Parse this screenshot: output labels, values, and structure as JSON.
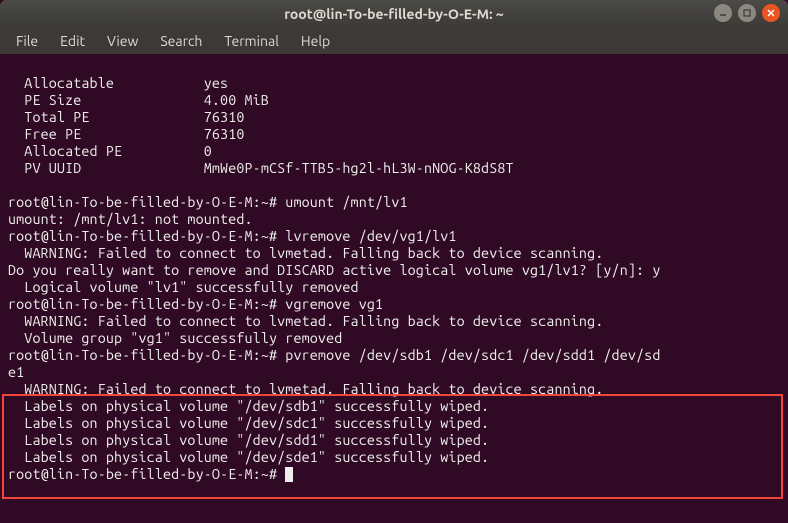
{
  "window": {
    "title": "root@lin-To-be-filled-by-O-E-M: ~"
  },
  "menu": {
    "file": "File",
    "edit": "Edit",
    "view": "View",
    "search": "Search",
    "terminal": "Terminal",
    "help": "Help"
  },
  "term": {
    "l01": "  Allocatable           yes",
    "l02": "  PE Size               4.00 MiB",
    "l03": "  Total PE              76310",
    "l04": "  Free PE               76310",
    "l05": "  Allocated PE          0",
    "l06": "  PV UUID               MmWe0P-mCSf-TTB5-hg2l-hL3W-nNOG-K8dS8T",
    "l07": "   ",
    "l08": "root@lin-To-be-filled-by-O-E-M:~# umount /mnt/lv1",
    "l09": "umount: /mnt/lv1: not mounted.",
    "l10": "root@lin-To-be-filled-by-O-E-M:~# lvremove /dev/vg1/lv1",
    "l11": "  WARNING: Failed to connect to lvmetad. Falling back to device scanning.",
    "l12": "Do you really want to remove and DISCARD active logical volume vg1/lv1? [y/n]: y",
    "l13": "  Logical volume \"lv1\" successfully removed",
    "l14": "root@lin-To-be-filled-by-O-E-M:~# vgremove vg1",
    "l15": "  WARNING: Failed to connect to lvmetad. Falling back to device scanning.",
    "l16": "  Volume group \"vg1\" successfully removed",
    "l17": "root@lin-To-be-filled-by-O-E-M:~# pvremove /dev/sdb1 /dev/sdc1 /dev/sdd1 /dev/sd",
    "l18": "e1",
    "l19": "  WARNING: Failed to connect to lvmetad. Falling back to device scanning.",
    "l20": "  Labels on physical volume \"/dev/sdb1\" successfully wiped.",
    "l21": "  Labels on physical volume \"/dev/sdc1\" successfully wiped.",
    "l22": "  Labels on physical volume \"/dev/sdd1\" successfully wiped.",
    "l23": "  Labels on physical volume \"/dev/sde1\" successfully wiped.",
    "l24": "root@lin-To-be-filled-by-O-E-M:~# "
  }
}
